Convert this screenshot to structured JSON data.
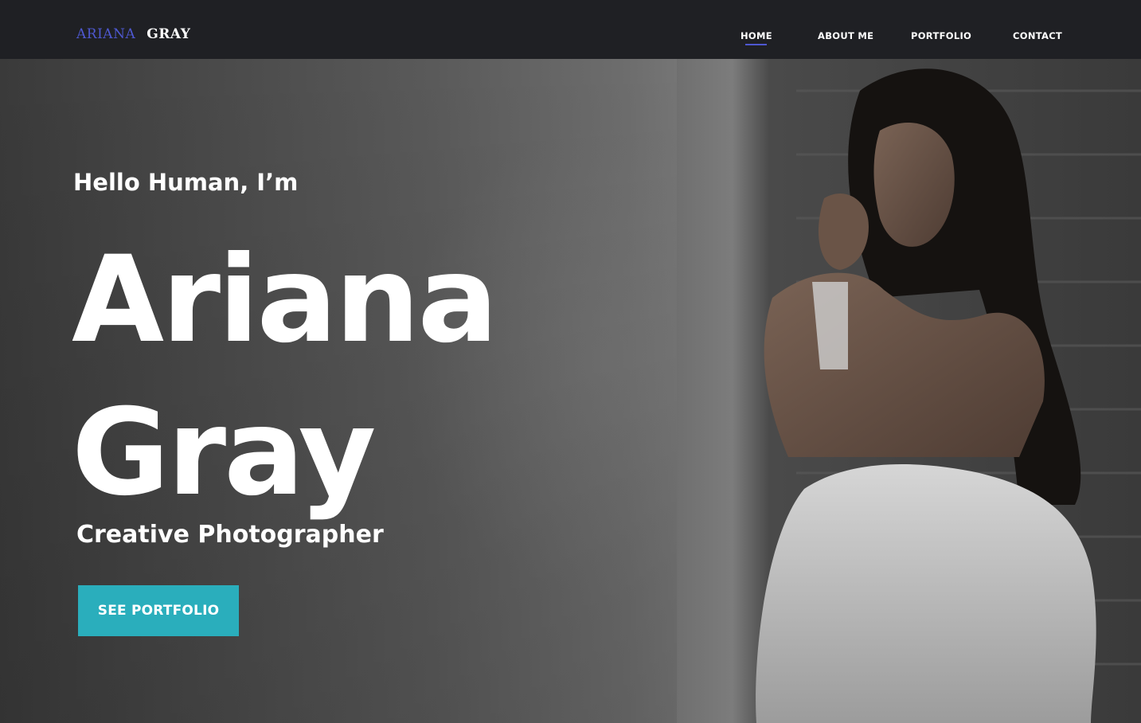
{
  "header": {
    "logo_first": "ARIANA",
    "logo_last": "GRAY",
    "nav": {
      "home": "HOME",
      "about": "ABOUT ME",
      "portfolio": "PORTFOLIO",
      "contact": "CONTACT"
    },
    "active_item": "HOME"
  },
  "hero": {
    "greeting": "Hello Human, I’m",
    "name_first": "Ariana",
    "name_last": "Gray",
    "subtitle": "Creative Photographer",
    "cta_label": "SEE PORTFOLIO"
  },
  "colors": {
    "header_bg": "#1f2024",
    "accent": "#4e58d0",
    "button_bg": "#2aaebc",
    "text": "#ffffff"
  }
}
